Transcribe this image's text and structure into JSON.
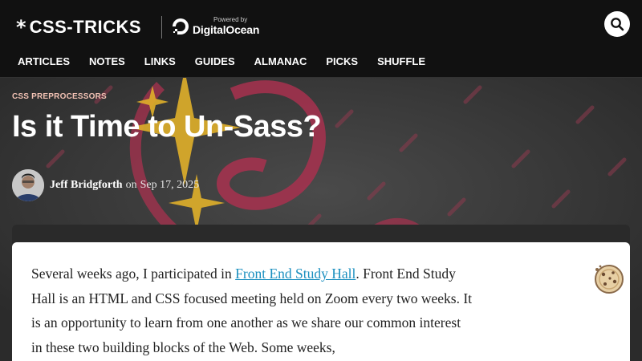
{
  "header": {
    "logo_star": "*",
    "logo_text": "CSS-TRICKS",
    "sponsor_powered": "Powered by",
    "sponsor_name": "DigitalOcean",
    "nav": [
      "ARTICLES",
      "NOTES",
      "LINKS",
      "GUIDES",
      "ALMANAC",
      "PICKS",
      "SHUFFLE"
    ]
  },
  "hero": {
    "category": "CSS PREPROCESSORS",
    "title": "Is it Time to Un-Sass?",
    "author": "Jeff Bridgforth",
    "date_prefix": "on",
    "date": "Sep 17, 2025"
  },
  "article": {
    "intro_before_link": "Several weeks ago, I participated in ",
    "link_text": "Front End Study Hall",
    "intro_after_link": ". Front End Study Hall is an HTML and CSS focused meeting held on Zoom every two weeks. It is an opportunity to learn from one another as we share our common interest in these two building blocks of the Web. Some weeks,"
  },
  "colors": {
    "header_bg": "#111111",
    "category": "#f2c2b4",
    "link": "#1a8fbf",
    "hero_accent": "#a8314f",
    "hero_star": "#e0b02a"
  },
  "icons": [
    "search-icon",
    "digitalocean-logo-icon",
    "cookie-icon"
  ]
}
